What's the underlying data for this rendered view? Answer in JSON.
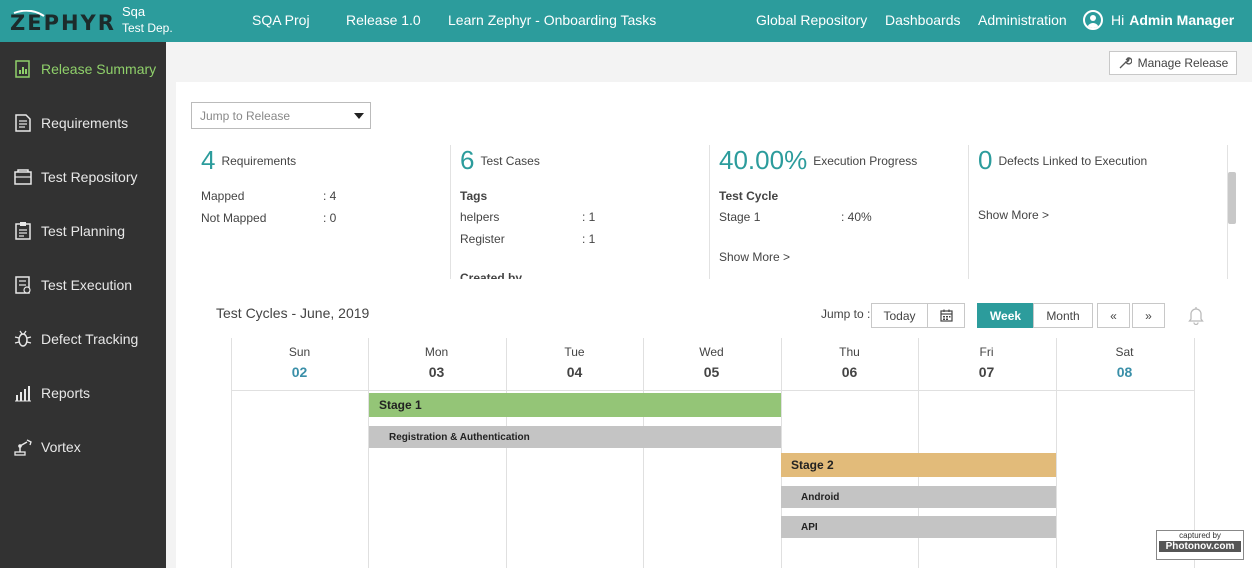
{
  "header": {
    "logo": "ZEPHYR",
    "project": "Sqa",
    "department": "Test Dep.",
    "nav": [
      "SQA Proj",
      "Release 1.0",
      "Learn Zephyr - Onboarding Tasks",
      "Global Repository",
      "Dashboards",
      "Administration"
    ],
    "greeting": "Hi",
    "user": "Admin Manager"
  },
  "sidebar": {
    "items": [
      {
        "label": "Release Summary",
        "icon": "release-summary-icon"
      },
      {
        "label": "Requirements",
        "icon": "requirements-icon"
      },
      {
        "label": "Test Repository",
        "icon": "test-repository-icon"
      },
      {
        "label": "Test Planning",
        "icon": "test-planning-icon"
      },
      {
        "label": "Test Execution",
        "icon": "test-execution-icon"
      },
      {
        "label": "Defect Tracking",
        "icon": "bug-icon"
      },
      {
        "label": "Reports",
        "icon": "bar-chart-icon"
      },
      {
        "label": "Vortex",
        "icon": "robot-arm-icon"
      }
    ],
    "active_index": 0
  },
  "toolbar": {
    "manage_release": "Manage Release"
  },
  "jump_release": {
    "placeholder": "Jump to Release"
  },
  "stats": {
    "requirements": {
      "count": "4",
      "label": "Requirements",
      "mapped_label": "Mapped",
      "mapped": ": 4",
      "not_mapped_label": "Not Mapped",
      "not_mapped": ": 0"
    },
    "testcases": {
      "count": "6",
      "label": "Test Cases",
      "tags_label": "Tags",
      "tag1": "helpers",
      "tag1_val": ": 1",
      "tag2": "Register",
      "tag2_val": ": 1",
      "created_by": "Created by"
    },
    "execution": {
      "percent": "40.00%",
      "label": "Execution Progress",
      "cycle_label": "Test Cycle",
      "cycle": "Stage 1",
      "cycle_val": ": 40%",
      "show_more": "Show More >"
    },
    "defects": {
      "count": "0",
      "label": "Defects Linked to Execution",
      "show_more": "Show More >"
    }
  },
  "calendar": {
    "title": "Test Cycles - June, 2019",
    "jump_to": "Jump to :",
    "today": "Today",
    "week": "Week",
    "month": "Month",
    "prev": "«",
    "next": "»",
    "days": [
      {
        "name": "Sun",
        "num": "02"
      },
      {
        "name": "Mon",
        "num": "03"
      },
      {
        "name": "Tue",
        "num": "04"
      },
      {
        "name": "Wed",
        "num": "05"
      },
      {
        "name": "Thu",
        "num": "06"
      },
      {
        "name": "Fri",
        "num": "07"
      },
      {
        "name": "Sat",
        "num": "08"
      }
    ],
    "events": {
      "stage1": "Stage 1",
      "reg_auth": "Registration & Authentication",
      "stage2": "Stage 2",
      "android": "Android",
      "api": "API"
    }
  },
  "watermark": {
    "line1": "captured by",
    "line2": "Photonov.com"
  },
  "colors": {
    "accent": "#2c9c9c",
    "sidebar": "#323232",
    "active": "#8fd06a",
    "stage1": "#94c577",
    "stage2": "#e2bb7a",
    "phase": "#c4c4c4"
  }
}
